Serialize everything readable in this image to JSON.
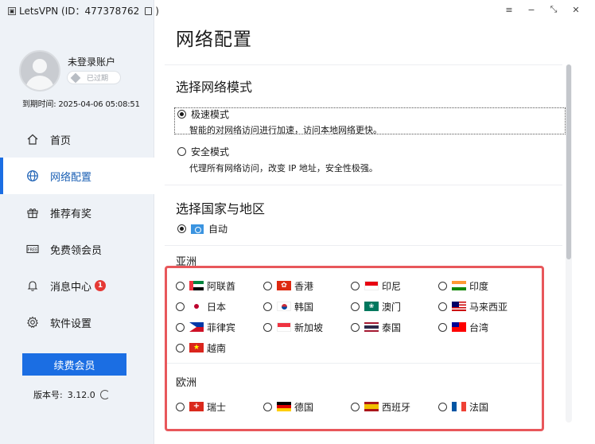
{
  "app": {
    "title": "LetsVPN (ID：477378762",
    "title_suffix": ")"
  },
  "user": {
    "name": "未登录账户",
    "badge": "已过期",
    "expire": "到期时间: 2025-04-06 05:08:51"
  },
  "nav": [
    {
      "label": "首页",
      "icon": "home-icon"
    },
    {
      "label": "网络配置",
      "icon": "globe-icon",
      "active": true
    },
    {
      "label": "推荐有奖",
      "icon": "gift-icon"
    },
    {
      "label": "免费领会员",
      "icon": "free-ticket-icon"
    },
    {
      "label": "消息中心",
      "icon": "bell-icon",
      "badge": "1"
    },
    {
      "label": "软件设置",
      "icon": "gear-icon"
    }
  ],
  "renew_label": "续费会员",
  "version": {
    "label": "版本号:",
    "value": "3.12.0"
  },
  "page_title": "网络配置",
  "network_mode": {
    "title": "选择网络模式",
    "options": [
      {
        "label": "极速模式",
        "desc": "智能的对网络访问进行加速，访问本地网络更快。",
        "selected": true
      },
      {
        "label": "安全模式",
        "desc": "代理所有网络访问，改变 IP 地址，安全性极强。",
        "selected": false
      }
    ]
  },
  "region": {
    "title": "选择国家与地区",
    "auto_label": "自动",
    "asia_label": "亚洲",
    "asia": [
      {
        "name": "阿联酋",
        "flag": "ae"
      },
      {
        "name": "香港",
        "flag": "hk"
      },
      {
        "name": "印尼",
        "flag": "id"
      },
      {
        "name": "印度",
        "flag": "in"
      },
      {
        "name": "日本",
        "flag": "jp"
      },
      {
        "name": "韩国",
        "flag": "kr"
      },
      {
        "name": "澳门",
        "flag": "mo"
      },
      {
        "name": "马来西亚",
        "flag": "my"
      },
      {
        "name": "菲律宾",
        "flag": "ph"
      },
      {
        "name": "新加坡",
        "flag": "sg"
      },
      {
        "name": "泰国",
        "flag": "th"
      },
      {
        "name": "台湾",
        "flag": "tw"
      },
      {
        "name": "越南",
        "flag": "vn"
      }
    ],
    "europe_label": "欧洲",
    "europe": [
      {
        "name": "瑞士",
        "flag": "ch"
      },
      {
        "name": "德国",
        "flag": "de"
      },
      {
        "name": "西班牙",
        "flag": "es"
      },
      {
        "name": "法国",
        "flag": "fr"
      }
    ]
  },
  "colors": {
    "accent": "#1b6ee3",
    "highlight": "#e8575b",
    "sidebar_bg": "#eef2f7"
  }
}
